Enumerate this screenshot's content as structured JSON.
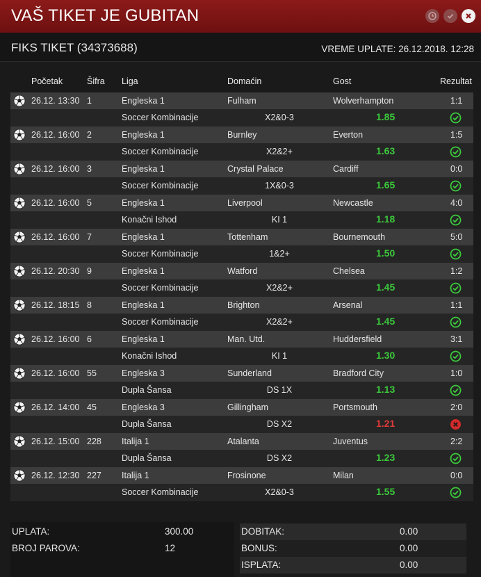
{
  "window": {
    "title": "VAŠ TIKET JE GUBITAN"
  },
  "ticket": {
    "label": "FIKS TIKET (34373688)",
    "paid_time": "VREME UPLATE: 26.12.2018. 12:28"
  },
  "columns": {
    "start": "Početak",
    "code": "Šifra",
    "league": "Liga",
    "home": "Domaćin",
    "away": "Gost",
    "result": "Rezultat"
  },
  "colors": {
    "title_bar": "#7d1414",
    "win": "#3cc93c",
    "lose": "#e03a3a"
  },
  "matches": [
    {
      "start": "26.12. 13:30",
      "code": "1",
      "league": "Engleska 1",
      "home": "Fulham",
      "away": "Wolverhampton",
      "result": "1:1",
      "market": "Soccer Kombinacije",
      "pick": "X2&0-3",
      "odds": "1.85",
      "status": "win",
      "status_icon": "check-circle-icon"
    },
    {
      "start": "26.12. 16:00",
      "code": "2",
      "league": "Engleska 1",
      "home": "Burnley",
      "away": "Everton",
      "result": "1:5",
      "market": "Soccer Kombinacije",
      "pick": "X2&2+",
      "odds": "1.63",
      "status": "win",
      "status_icon": "check-circle-icon"
    },
    {
      "start": "26.12. 16:00",
      "code": "3",
      "league": "Engleska 1",
      "home": "Crystal Palace",
      "away": "Cardiff",
      "result": "0:0",
      "market": "Soccer Kombinacije",
      "pick": "1X&0-3",
      "odds": "1.65",
      "status": "win",
      "status_icon": "check-circle-icon"
    },
    {
      "start": "26.12. 16:00",
      "code": "5",
      "league": "Engleska 1",
      "home": "Liverpool",
      "away": "Newcastle",
      "result": "4:0",
      "market": "Konačni Ishod",
      "pick": "KI 1",
      "odds": "1.18",
      "status": "win",
      "status_icon": "check-circle-icon"
    },
    {
      "start": "26.12. 16:00",
      "code": "7",
      "league": "Engleska 1",
      "home": "Tottenham",
      "away": "Bournemouth",
      "result": "5:0",
      "market": "Soccer Kombinacije",
      "pick": "1&2+",
      "odds": "1.50",
      "status": "win",
      "status_icon": "check-circle-icon"
    },
    {
      "start": "26.12. 20:30",
      "code": "9",
      "league": "Engleska 1",
      "home": "Watford",
      "away": "Chelsea",
      "result": "1:2",
      "market": "Soccer Kombinacije",
      "pick": "X2&2+",
      "odds": "1.45",
      "status": "win",
      "status_icon": "check-circle-icon"
    },
    {
      "start": "26.12. 18:15",
      "code": "8",
      "league": "Engleska 1",
      "home": "Brighton",
      "away": "Arsenal",
      "result": "1:1",
      "market": "Soccer Kombinacije",
      "pick": "X2&2+",
      "odds": "1.45",
      "status": "win",
      "status_icon": "check-circle-icon"
    },
    {
      "start": "26.12. 16:00",
      "code": "6",
      "league": "Engleska 1",
      "home": "Man. Utd.",
      "away": "Huddersfield",
      "result": "3:1",
      "market": "Konačni Ishod",
      "pick": "KI 1",
      "odds": "1.30",
      "status": "win",
      "status_icon": "check-circle-icon"
    },
    {
      "start": "26.12. 16:00",
      "code": "55",
      "league": "Engleska 3",
      "home": "Sunderland",
      "away": "Bradford City",
      "result": "1:0",
      "market": "Dupla Šansa",
      "pick": "DS 1X",
      "odds": "1.13",
      "status": "win",
      "status_icon": "check-circle-icon"
    },
    {
      "start": "26.12. 14:00",
      "code": "45",
      "league": "Engleska 3",
      "home": "Gillingham",
      "away": "Portsmouth",
      "result": "2:0",
      "market": "Dupla Šansa",
      "pick": "DS X2",
      "odds": "1.21",
      "status": "lose",
      "status_icon": "x-circle-icon"
    },
    {
      "start": "26.12. 15:00",
      "code": "228",
      "league": "Italija 1",
      "home": "Atalanta",
      "away": "Juventus",
      "result": "2:2",
      "market": "Dupla Šansa",
      "pick": "DS X2",
      "odds": "1.23",
      "status": "win",
      "status_icon": "check-circle-icon"
    },
    {
      "start": "26.12. 12:30",
      "code": "227",
      "league": "Italija 1",
      "home": "Frosinone",
      "away": "Milan",
      "result": "0:0",
      "market": "Soccer Kombinacije",
      "pick": "X2&0-3",
      "odds": "1.55",
      "status": "win",
      "status_icon": "check-circle-icon"
    }
  ],
  "summary": {
    "stake_label": "UPLATA:",
    "stake_value": "300.00",
    "pairs_label": "BROJ PAROVA:",
    "pairs_value": "12",
    "win_label": "DOBITAK:",
    "win_value": "0.00",
    "bonus_label": "BONUS:",
    "bonus_value": "0.00",
    "payout_label": "ISPLATA:",
    "payout_value": "0.00"
  }
}
